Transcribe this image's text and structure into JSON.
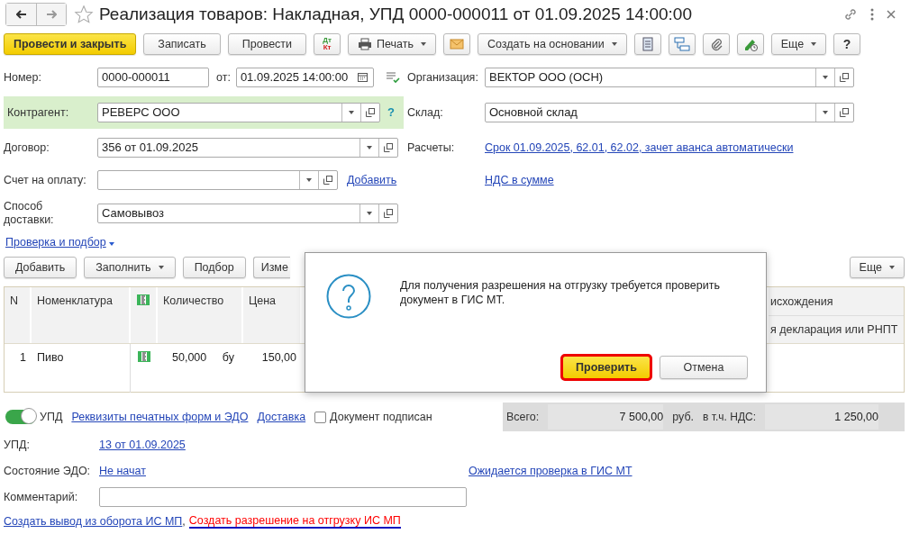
{
  "window": {
    "title": "Реализация товаров: Накладная, УПД 0000-000011 от 01.09.2025 14:00:00",
    "favorite": false
  },
  "toolbar": [
    {
      "kind": "primary",
      "label": "Провести и закрыть"
    },
    {
      "kind": "button",
      "label": "Записать"
    },
    {
      "kind": "button",
      "label": "Провести"
    },
    {
      "kind": "dtkt",
      "dt": "Дт",
      "kt": "Кт"
    },
    {
      "kind": "print",
      "label": "Печать"
    },
    {
      "kind": "mail"
    },
    {
      "kind": "dropdown",
      "label": "Создать на основании"
    },
    {
      "kind": "list"
    },
    {
      "kind": "structure"
    },
    {
      "kind": "clip"
    },
    {
      "kind": "sign"
    },
    {
      "kind": "dropdown",
      "label": "Еще"
    },
    {
      "kind": "help",
      "label": "?"
    }
  ],
  "number": {
    "label": "Номер:",
    "value": "0000-000011",
    "date_label": "от:",
    "date": "01.09.2025 14:00:00"
  },
  "organization": {
    "label": "Организация:",
    "value": "ВЕКТОР ООО (ОСН)"
  },
  "counterparty": {
    "label": "Контрагент:",
    "value": "РЕВЕРС ООО",
    "highlighted": true,
    "help": "?"
  },
  "warehouse": {
    "label": "Склад:",
    "value": "Основной склад"
  },
  "contract": {
    "label": "Договор:",
    "value": "356 от 01.09.2025"
  },
  "settlements": {
    "label": "Расчеты:",
    "link": "Срок 01.09.2025, 62.01, 62.02, зачет аванса автоматически"
  },
  "invoice": {
    "label": "Счет на оплату:",
    "link": "Добавить"
  },
  "vat_link": "НДС в сумме",
  "delivery": {
    "label": "Способ доставки:",
    "value": "Самовывоз"
  },
  "check_menu": "Проверка и подбор",
  "table_toolbar": {
    "buttons": [
      {
        "label": "Добавить",
        "dropdown": false
      },
      {
        "label": "Заполнить",
        "dropdown": true
      },
      {
        "label": "Подбор",
        "dropdown": false
      },
      {
        "label": "Изме",
        "dropdown": false
      }
    ],
    "more": "Еще"
  },
  "table": {
    "columns": [
      "N",
      "Номенклатура",
      "Количество",
      "Цена"
    ],
    "cut_column": {
      "header": "исхождения",
      "subheader": "я декларация или РНПТ"
    },
    "rows": [
      {
        "n": "1",
        "name": "Пиво",
        "marked": true,
        "quantity": "50,000",
        "unit": "бу",
        "price": "150,00"
      }
    ]
  },
  "dialog": {
    "message": "Для получения разрешения на отгрузку требуется проверить документ в ГИС МТ.",
    "buttons": [
      {
        "label": "Проверить",
        "default": true,
        "outlined": true
      },
      {
        "label": "Отмена",
        "default": false,
        "outlined": false
      }
    ]
  },
  "footer": {
    "upd_toggle": {
      "label": "УПД",
      "on": true
    },
    "links": [
      "Реквизиты печатных форм и ЭДО",
      "Доставка"
    ],
    "signed": {
      "label": "Документ подписан",
      "checked": false
    },
    "totals": {
      "total_label": "Всего:",
      "total": "7 500,00",
      "currency": "руб.",
      "vat_label": "в т.ч. НДС:",
      "vat": "1 250,00"
    }
  },
  "upd": {
    "label": "УПД:",
    "link": "13 от 01.09.2025"
  },
  "edo": {
    "label": "Состояние ЭДО:",
    "link": "Не начат",
    "status_link": "Ожидается проверка в ГИС МТ"
  },
  "comment": {
    "label": "Комментарий:"
  },
  "bottom_links": [
    {
      "text": "Создать вывод из оборота ИС МП",
      "highlighted": false
    },
    {
      "text": "Создать разрешение на отгрузку ИС МП",
      "highlighted": true
    }
  ],
  "bottom_separator": ","
}
